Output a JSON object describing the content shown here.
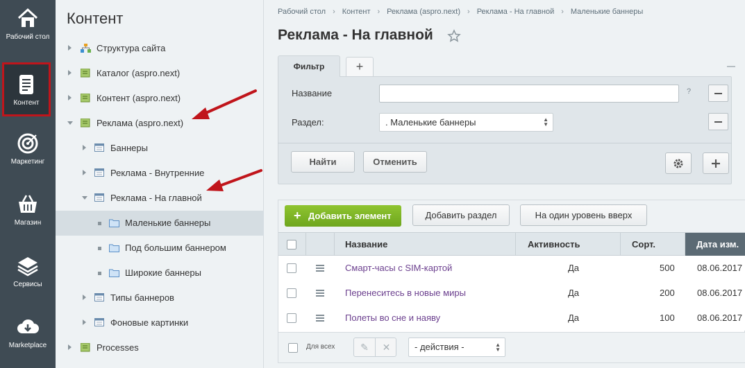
{
  "leftnav": {
    "items": [
      {
        "label": "Рабочий стол",
        "icon": "home-icon"
      },
      {
        "label": "Контент",
        "icon": "document-icon",
        "active": true
      },
      {
        "label": "Маркетинг",
        "icon": "target-icon"
      },
      {
        "label": "Магазин",
        "icon": "basket-icon"
      },
      {
        "label": "Сервисы",
        "icon": "layers-icon"
      },
      {
        "label": "Marketplace",
        "icon": "cloud-download-icon"
      }
    ],
    "active_border_color": "#c0151b"
  },
  "tree": {
    "title": "Контент",
    "items": [
      {
        "label": "Структура сайта",
        "icon": "site-structure-icon"
      },
      {
        "label": "Каталог (aspro.next)",
        "icon": "iblock-type-icon"
      },
      {
        "label": "Контент (aspro.next)",
        "icon": "iblock-type-icon"
      },
      {
        "label": "Реклама (aspro.next)",
        "icon": "iblock-type-icon",
        "expanded": true
      },
      {
        "label": "Баннеры",
        "icon": "iblock-icon"
      },
      {
        "label": "Реклама - Внутренние",
        "icon": "iblock-icon"
      },
      {
        "label": "Реклама - На главной",
        "icon": "iblock-icon",
        "expanded": true
      },
      {
        "label": "Маленькие баннеры",
        "icon": "folder-icon",
        "selected": true
      },
      {
        "label": "Под большим баннером",
        "icon": "folder-icon"
      },
      {
        "label": "Широкие баннеры",
        "icon": "folder-icon"
      },
      {
        "label": "Типы баннеров",
        "icon": "iblock-icon"
      },
      {
        "label": "Фоновые картинки",
        "icon": "iblock-icon"
      },
      {
        "label": "Processes",
        "icon": "iblock-type-icon"
      }
    ]
  },
  "breadcrumbs": [
    "Рабочий стол",
    "Контент",
    "Реклама (aspro.next)",
    "Реклама - На главной",
    "Маленькие баннеры"
  ],
  "page_title": "Реклама - На главной",
  "filter": {
    "tab_label": "Фильтр",
    "add_tab": "+",
    "name_label": "Название",
    "name_value": "",
    "help": "?",
    "section_label": "Раздел:",
    "section_value": ". Маленькие баннеры",
    "find_label": "Найти",
    "cancel_label": "Отменить"
  },
  "toolbar": {
    "add_element": "Добавить элемент",
    "add_section": "Добавить раздел",
    "level_up": "На один уровень вверх",
    "accent_color": "#7ab424"
  },
  "table": {
    "columns": [
      "Название",
      "Активность",
      "Сорт.",
      "Дата изм."
    ],
    "rows": [
      {
        "name": "Смарт-часы с SIM-картой",
        "active": "Да",
        "sort": "500",
        "date": "08.06.2017"
      },
      {
        "name": "Перенеситесь в новые миры",
        "active": "Да",
        "sort": "200",
        "date": "08.06.2017"
      },
      {
        "name": "Полеты во сне и наяву",
        "active": "Да",
        "sort": "100",
        "date": "08.06.2017"
      }
    ],
    "for_all": "Для всех",
    "actions_value": "- действия -"
  }
}
